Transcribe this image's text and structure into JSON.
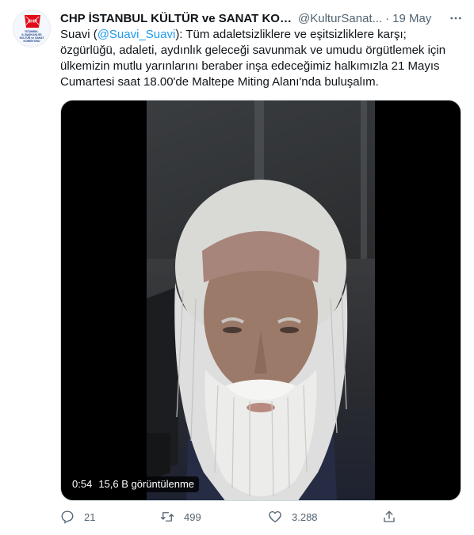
{
  "author": {
    "display_name": "CHP İSTANBUL KÜLTÜR ve SANAT KOM...",
    "handle": "@KulturSanat...",
    "separator": "·",
    "date": "19 May",
    "avatar_logo_text": "CHP",
    "avatar_caption_line1": "İSTANBUL",
    "avatar_caption_line2": "İL BAŞKANLIĞI",
    "avatar_caption_line3": "KÜLTÜR ve SANAT",
    "avatar_caption_line4": "KOMİSYONU"
  },
  "tweet": {
    "prefix": "Suavi (",
    "mention": "@Suavi_Suavi",
    "body": "): Tüm adaletsizliklere ve eşitsizliklere karşı; özgürlüğü, adaleti, aydınlık geleceği savunmak ve umudu örgütlemek için ülkemizin mutlu yarınlarını beraber inşa edeceğimiz halkımızla 21 Mayıs Cumartesi saat 18.00'de Maltepe Miting Alanı'nda buluşalım."
  },
  "video": {
    "duration": "0:54",
    "views": "15,6 B görüntülenme"
  },
  "actions": {
    "reply_count": "21",
    "retweet_count": "499",
    "like_count": "3.288"
  },
  "colors": {
    "accent": "#1d9bf0",
    "text": "#0f1419",
    "muted": "#536471",
    "brand_red": "#e30a17"
  }
}
